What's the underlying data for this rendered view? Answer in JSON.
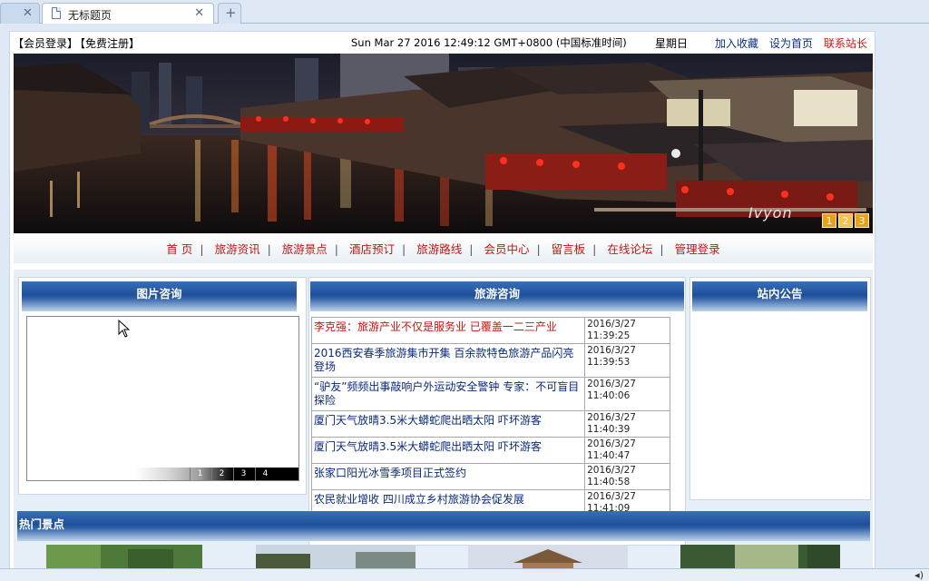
{
  "browser": {
    "tab_title": "无标题页",
    "new_tab": "+"
  },
  "topbar": {
    "login": "【会员登录】",
    "register": "【免费注册】",
    "clock": "Sun Mar 27 2016 12:49:12 GMT+0800 (中国标准时间)",
    "weekday": "星期日",
    "favorite": "加入收藏",
    "set_home": "设为首页",
    "contact": "联系站长"
  },
  "banner": {
    "logo": "Ivyon",
    "pages": [
      "1",
      "2",
      "3"
    ],
    "active_page": "2"
  },
  "nav": [
    "首 页",
    "旅游资讯",
    "旅游景点",
    "酒店预订",
    "旅游路线",
    "会员中心",
    "留言板",
    "在线论坛",
    "管理登录"
  ],
  "panels": {
    "photo": {
      "title": "图片咨询",
      "pages": [
        "1",
        "2",
        "3",
        "4"
      ]
    },
    "news": {
      "title": "旅游咨询",
      "items": [
        {
          "title": "李克强：旅游产业不仅是服务业 已覆盖一二三产业",
          "date": "2016/3/27",
          "time": "11:39:25",
          "highlight": true
        },
        {
          "title": "2016西安春季旅游集市开集 百余款特色旅游产品闪亮登场",
          "date": "2016/3/27",
          "time": "11:39:53",
          "highlight": false
        },
        {
          "title": "“驴友”频频出事敲响户外运动安全警钟 专家：不可盲目探险",
          "date": "2016/3/27",
          "time": "11:40:06",
          "highlight": false
        },
        {
          "title": "厦门天气放晴3.5米大蟒蛇爬出晒太阳 吓坏游客",
          "date": "2016/3/27",
          "time": "11:40:39",
          "highlight": false
        },
        {
          "title": "厦门天气放晴3.5米大蟒蛇爬出晒太阳 吓坏游客",
          "date": "2016/3/27",
          "time": "11:40:47",
          "highlight": false
        },
        {
          "title": "张家口阳光冰雪季项目正式签约",
          "date": "2016/3/27",
          "time": "11:40:58",
          "highlight": false
        },
        {
          "title": "农民就业增收 四川成立乡村旅游协会促发展",
          "date": "2016/3/27",
          "time": "11:41:09",
          "highlight": false
        }
      ]
    },
    "notice": {
      "title": "站内公告"
    }
  },
  "hot": {
    "title": "热门景点"
  }
}
